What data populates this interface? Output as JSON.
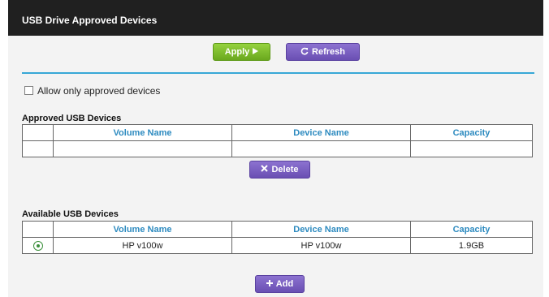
{
  "header": {
    "title": "USB Drive Approved Devices"
  },
  "toolbar": {
    "apply_label": "Apply",
    "apply_icon": "play-arrow-icon",
    "refresh_label": "Refresh",
    "refresh_icon": "refresh-icon"
  },
  "allow_only": {
    "label": "Allow only approved devices",
    "checked": false
  },
  "approved": {
    "title": "Approved USB Devices",
    "columns": [
      "",
      "Volume Name",
      "Device Name",
      "Capacity"
    ],
    "rows": [],
    "delete_label": "Delete",
    "delete_icon": "x-icon"
  },
  "available": {
    "title": "Available USB Devices",
    "columns": [
      "",
      "Volume Name",
      "Device Name",
      "Capacity"
    ],
    "rows": [
      {
        "selected": true,
        "volume_name": "HP v100w",
        "device_name": "HP v100w",
        "capacity": "1.9GB"
      }
    ],
    "add_label": "Add",
    "add_icon": "plus-icon"
  },
  "colors": {
    "title_bar": "#202020",
    "accent_rule": "#37a7d6",
    "header_text": "#2e8bc0",
    "apply_green": "#7bbb2c",
    "purple_button": "#6f55b8"
  }
}
